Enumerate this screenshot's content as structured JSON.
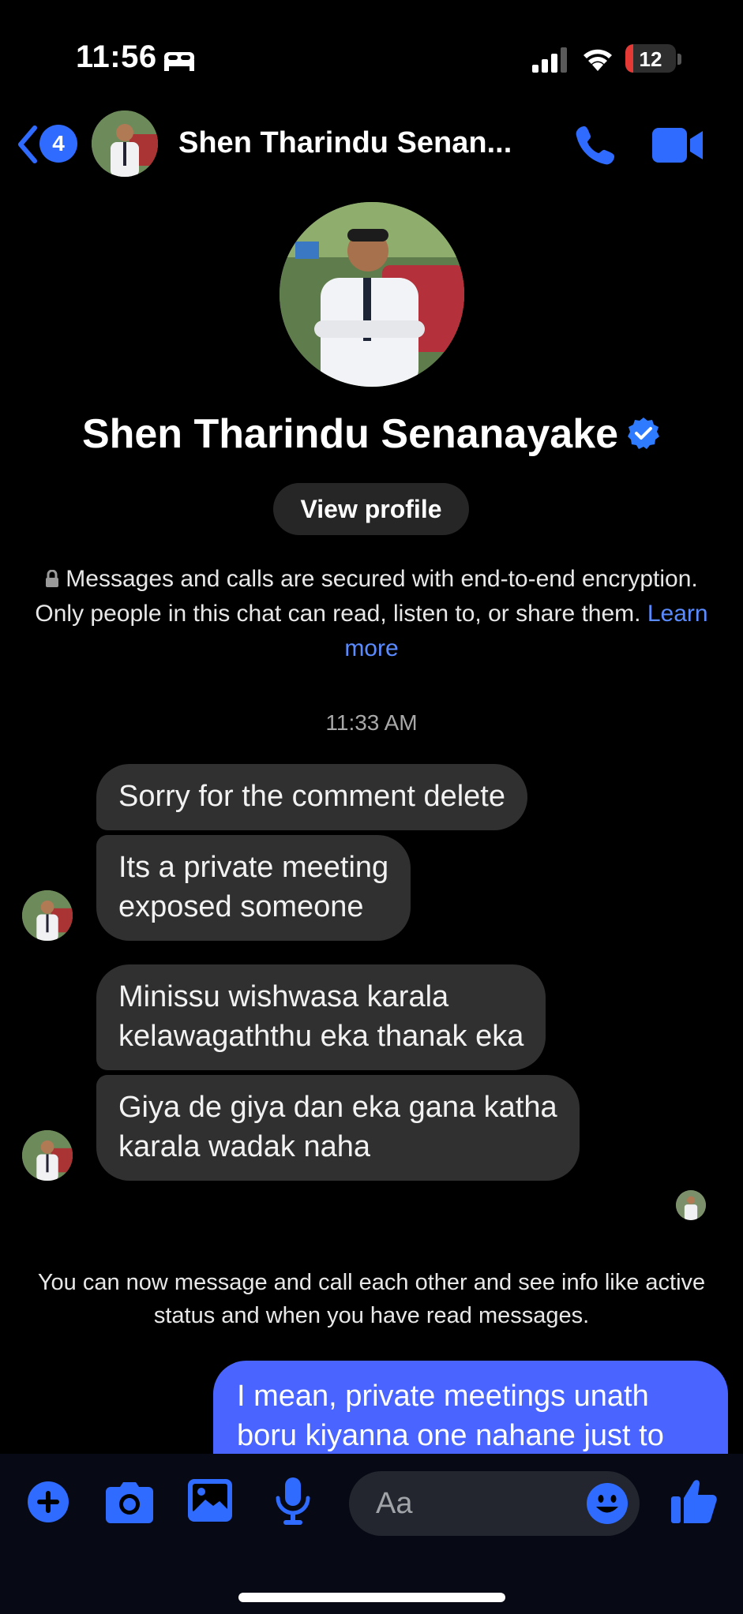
{
  "status_bar": {
    "time": "11:56",
    "battery": "12"
  },
  "header": {
    "back_badge": "4",
    "contact_name": "Shen Tharindu Senan..."
  },
  "profile": {
    "name": "Shen Tharindu Senanayake",
    "view_profile_label": "View profile"
  },
  "encryption_notice": {
    "text": "Messages and calls are secured with end-to-end encryption. Only people in this chat can read, listen to, or share them.",
    "link": "Learn more"
  },
  "timestamp": "11:33 AM",
  "messages": [
    {
      "text": "Sorry for the comment delete"
    },
    {
      "line1": "Its a private meeting",
      "line2": "exposed someone"
    },
    {
      "line1": "Minissu wishwasa karala",
      "line2": "kelawagaththu eka thanak eka"
    },
    {
      "line1": "Giya de giya dan eka gana katha",
      "line2": "karala wadak naha"
    }
  ],
  "system_notice": "You can now message and call each other and see info like active status and when you have read messages.",
  "sent_message": {
    "line1": "I mean, private meetings unath",
    "line2": "boru kiyanna one nahane just to"
  },
  "composer": {
    "placeholder": "Aa"
  },
  "colors": {
    "accent": "#2f6bff",
    "sent_bubble": "#4a64ff",
    "received_bubble": "#303030",
    "link": "#5a8cff"
  },
  "icons": [
    "bed-icon",
    "signal-icon",
    "wifi-icon",
    "chevron-left-icon",
    "phone-icon",
    "video-camera-icon",
    "verified-badge-icon",
    "lock-icon",
    "plus-icon",
    "camera-icon",
    "photo-icon",
    "microphone-icon",
    "emoji-icon",
    "thumbs-up-icon"
  ]
}
